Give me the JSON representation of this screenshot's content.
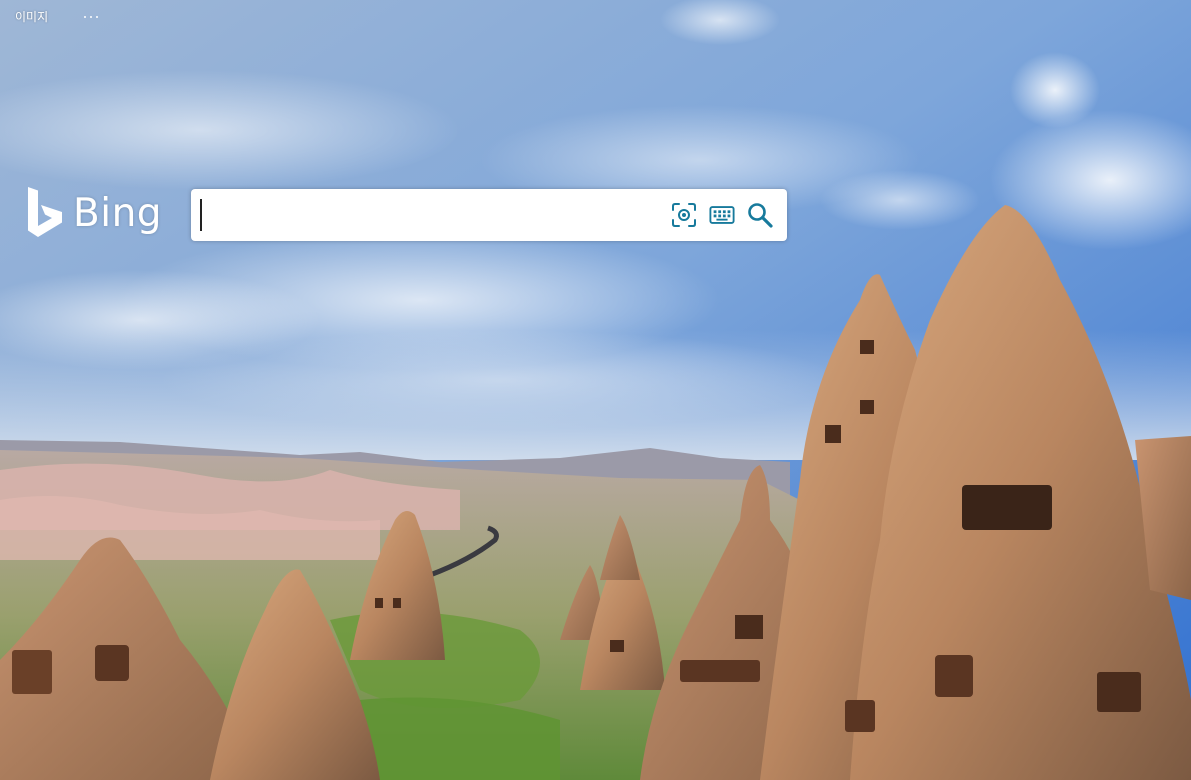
{
  "nav": {
    "images_label": "이미지",
    "more_label": "···"
  },
  "logo": {
    "text": "Bing"
  },
  "search": {
    "value": "",
    "placeholder": ""
  },
  "icons": {
    "visual_search": "visual-search-icon",
    "keyboard": "keyboard-icon",
    "search": "search-icon"
  },
  "colors": {
    "accent": "#177a9c",
    "search_box": "#ffffff",
    "nav_text": "#ffffff"
  }
}
